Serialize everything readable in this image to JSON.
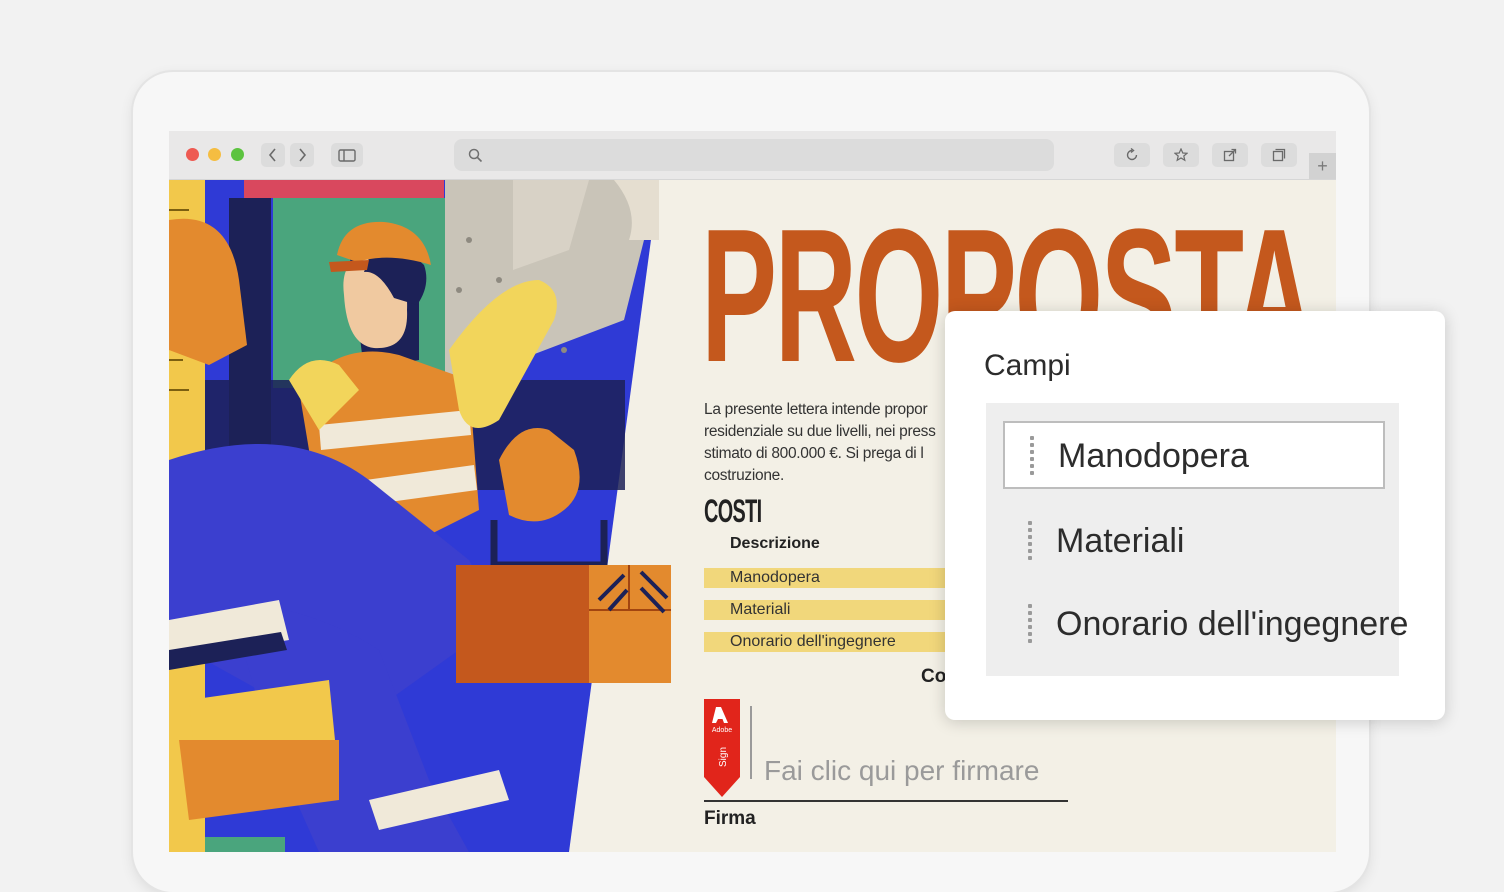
{
  "browser": {
    "toolbar_icons": [
      "back-chevron-icon",
      "forward-chevron-icon",
      "sidebar-icon",
      "search-icon",
      "reload-icon",
      "bookmark-star-icon",
      "share-icon",
      "tabs-icon",
      "plus-icon"
    ],
    "traffic_light_colors": [
      "#ee5a52",
      "#f5bd41",
      "#5cc33f"
    ]
  },
  "document": {
    "title": "PROPOSTA",
    "intro": "La presente lettera intende propor residenziale su due livelli, nei press stimato di 800.000 €. Si prega di l costruzione.",
    "costs_heading": "COSTI",
    "description_header": "Descrizione",
    "cost_rows": [
      {
        "label": "Manodopera"
      },
      {
        "label": "Materiali"
      },
      {
        "label": "Onorario dell'ingegnere"
      }
    ],
    "truncated_text": "Co",
    "sign_badge_brand": "Adobe",
    "sign_badge_product": "Sign",
    "signature_placeholder": "Fai clic qui per firmare",
    "signature_label": "Firma",
    "accent_color": "#c4581d",
    "highlight_color": "#f1d77b"
  },
  "fields_panel": {
    "title": "Campi",
    "fields": [
      {
        "label": "Manodopera",
        "selected": true
      },
      {
        "label": "Materiali",
        "selected": false
      },
      {
        "label": "Onorario dell'ingegnere",
        "selected": false
      }
    ]
  }
}
